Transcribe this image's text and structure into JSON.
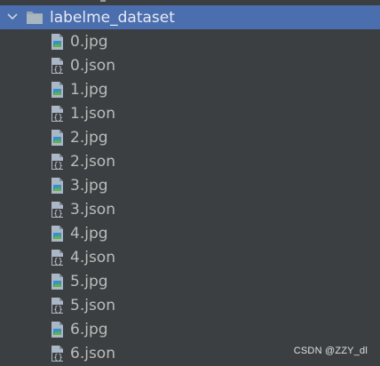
{
  "colors": {
    "background": "#3c3f41",
    "selection": "#4b6eaf",
    "text": "#bbbbbb",
    "selected_text": "#e7ebf2",
    "folder_icon": "#9aa7b0",
    "file_icon": "#a9b7c6",
    "image_badge_green": "#62b543",
    "image_badge_blue": "#3592c4"
  },
  "tree": {
    "folder": {
      "name": "labelme_dataset",
      "expanded": true,
      "chevron_icon": "chevron-down-icon",
      "icon": "folder-icon"
    },
    "files": [
      {
        "name": "0.jpg",
        "icon": "image-file-icon"
      },
      {
        "name": "0.json",
        "icon": "json-file-icon"
      },
      {
        "name": "1.jpg",
        "icon": "image-file-icon"
      },
      {
        "name": "1.json",
        "icon": "json-file-icon"
      },
      {
        "name": "2.jpg",
        "icon": "image-file-icon"
      },
      {
        "name": "2.json",
        "icon": "json-file-icon"
      },
      {
        "name": "3.jpg",
        "icon": "image-file-icon"
      },
      {
        "name": "3.json",
        "icon": "json-file-icon"
      },
      {
        "name": "4.jpg",
        "icon": "image-file-icon"
      },
      {
        "name": "4.json",
        "icon": "json-file-icon"
      },
      {
        "name": "5.jpg",
        "icon": "image-file-icon"
      },
      {
        "name": "5.json",
        "icon": "json-file-icon"
      },
      {
        "name": "6.jpg",
        "icon": "image-file-icon"
      },
      {
        "name": "6.json",
        "icon": "json-file-icon"
      }
    ]
  },
  "watermark": "CSDN @ZZY_dl"
}
